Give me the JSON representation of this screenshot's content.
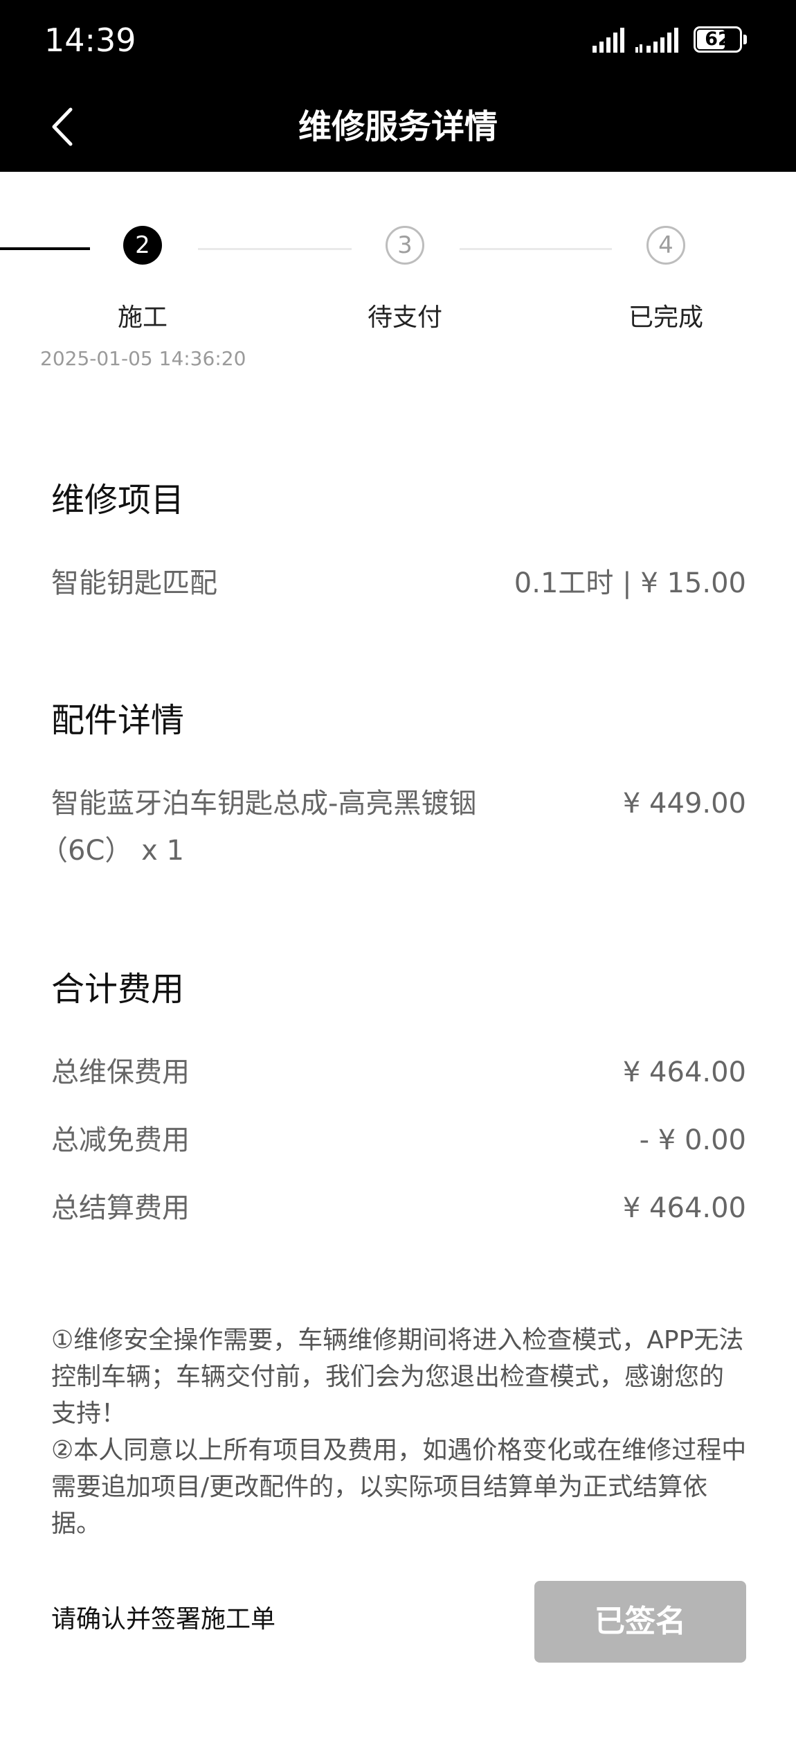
{
  "status_bar": {
    "time": "14:39",
    "battery": "62"
  },
  "header": {
    "title": "维修服务详情"
  },
  "steps": [
    {
      "number": "2",
      "label": "施工",
      "date": "2025-01-05 14:36:20",
      "state": "active"
    },
    {
      "number": "3",
      "label": "待支付",
      "state": "pending"
    },
    {
      "number": "4",
      "label": "已完成",
      "state": "pending"
    }
  ],
  "repair_items": {
    "title": "维修项目",
    "items": [
      {
        "name": "智能钥匙匹配",
        "value": "0.1工时 | ¥ 15.00"
      }
    ]
  },
  "parts": {
    "title": "配件详情",
    "items": [
      {
        "name_line1": "智能蓝牙泊车钥匙总成-高亮黑镀铟",
        "name_line2": "（6C） x 1",
        "value": "¥ 449.00"
      }
    ]
  },
  "totals": {
    "title": "合计费用",
    "rows": [
      {
        "label": "总维保费用",
        "value": "¥ 464.00"
      },
      {
        "label": "总减免费用",
        "value": "- ¥ 0.00"
      },
      {
        "label": "总结算费用",
        "value": "¥ 464.00"
      }
    ]
  },
  "notes": [
    "①维修安全操作需要，车辆维修期间将进入检查模式，APP无法控制车辆；车辆交付前，我们会为您退出检查模式，感谢您的支持！",
    "②本人同意以上所有项目及费用，如遇价格变化或在维修过程中需要追加项目/更改配件的，以实际项目结算单为正式结算依据。"
  ],
  "footer": {
    "confirm_text": "请确认并签署施工单",
    "sign_button": "已签名"
  },
  "colors": {
    "header_bg": "#000000",
    "button_disabled": "#b5b5b5",
    "secondary_text": "#666666"
  }
}
